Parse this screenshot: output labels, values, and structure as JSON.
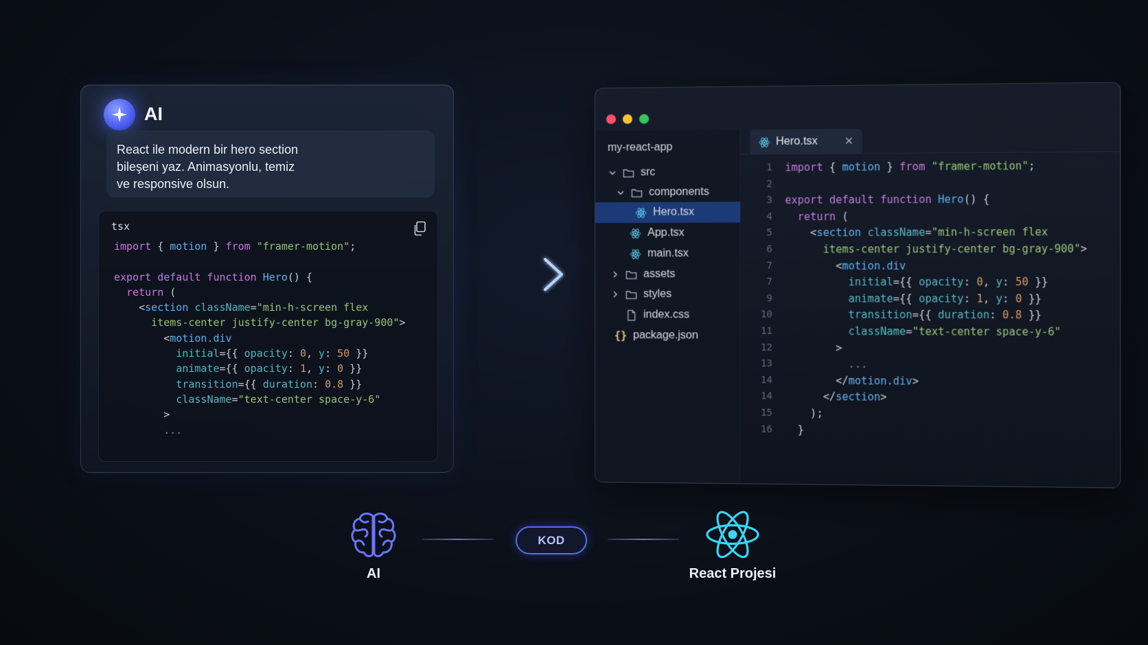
{
  "ai_card": {
    "title": "AI",
    "prompt_line1": "React ile modern bir hero section",
    "prompt_line2": "bileşeni yaz. Animasyonlu, temiz",
    "prompt_line3": "ve responsive olsun.",
    "code_lang": "tsx",
    "copy_icon": "copy-icon"
  },
  "ide": {
    "window_controls": [
      "close-dot",
      "minimize-dot",
      "maximize-dot"
    ],
    "project_name": "my-react-app",
    "tree": {
      "src": "src",
      "components": "components",
      "hero": "Hero.tsx",
      "app": "App.tsx",
      "main": "main.tsx",
      "assets": "assets",
      "styles": "styles",
      "index_css": "index.css",
      "package_json": "package.json"
    },
    "active_tab": "Hero.tsx",
    "line_numbers": [
      "1",
      "2",
      "3",
      "4",
      "5",
      "6",
      "7",
      "7",
      "9",
      "10",
      "11",
      "12",
      "13",
      "14",
      "14",
      "15",
      "16"
    ]
  },
  "flow": {
    "left_label": "AI",
    "middle_label": "KOD",
    "right_label": "React Projesi"
  },
  "colors": {
    "accent": "#5a6cf0",
    "active_row": "#1c3a78",
    "dot_red": "#ff4f6d",
    "dot_yellow": "#f5c233",
    "dot_green": "#34c759"
  }
}
